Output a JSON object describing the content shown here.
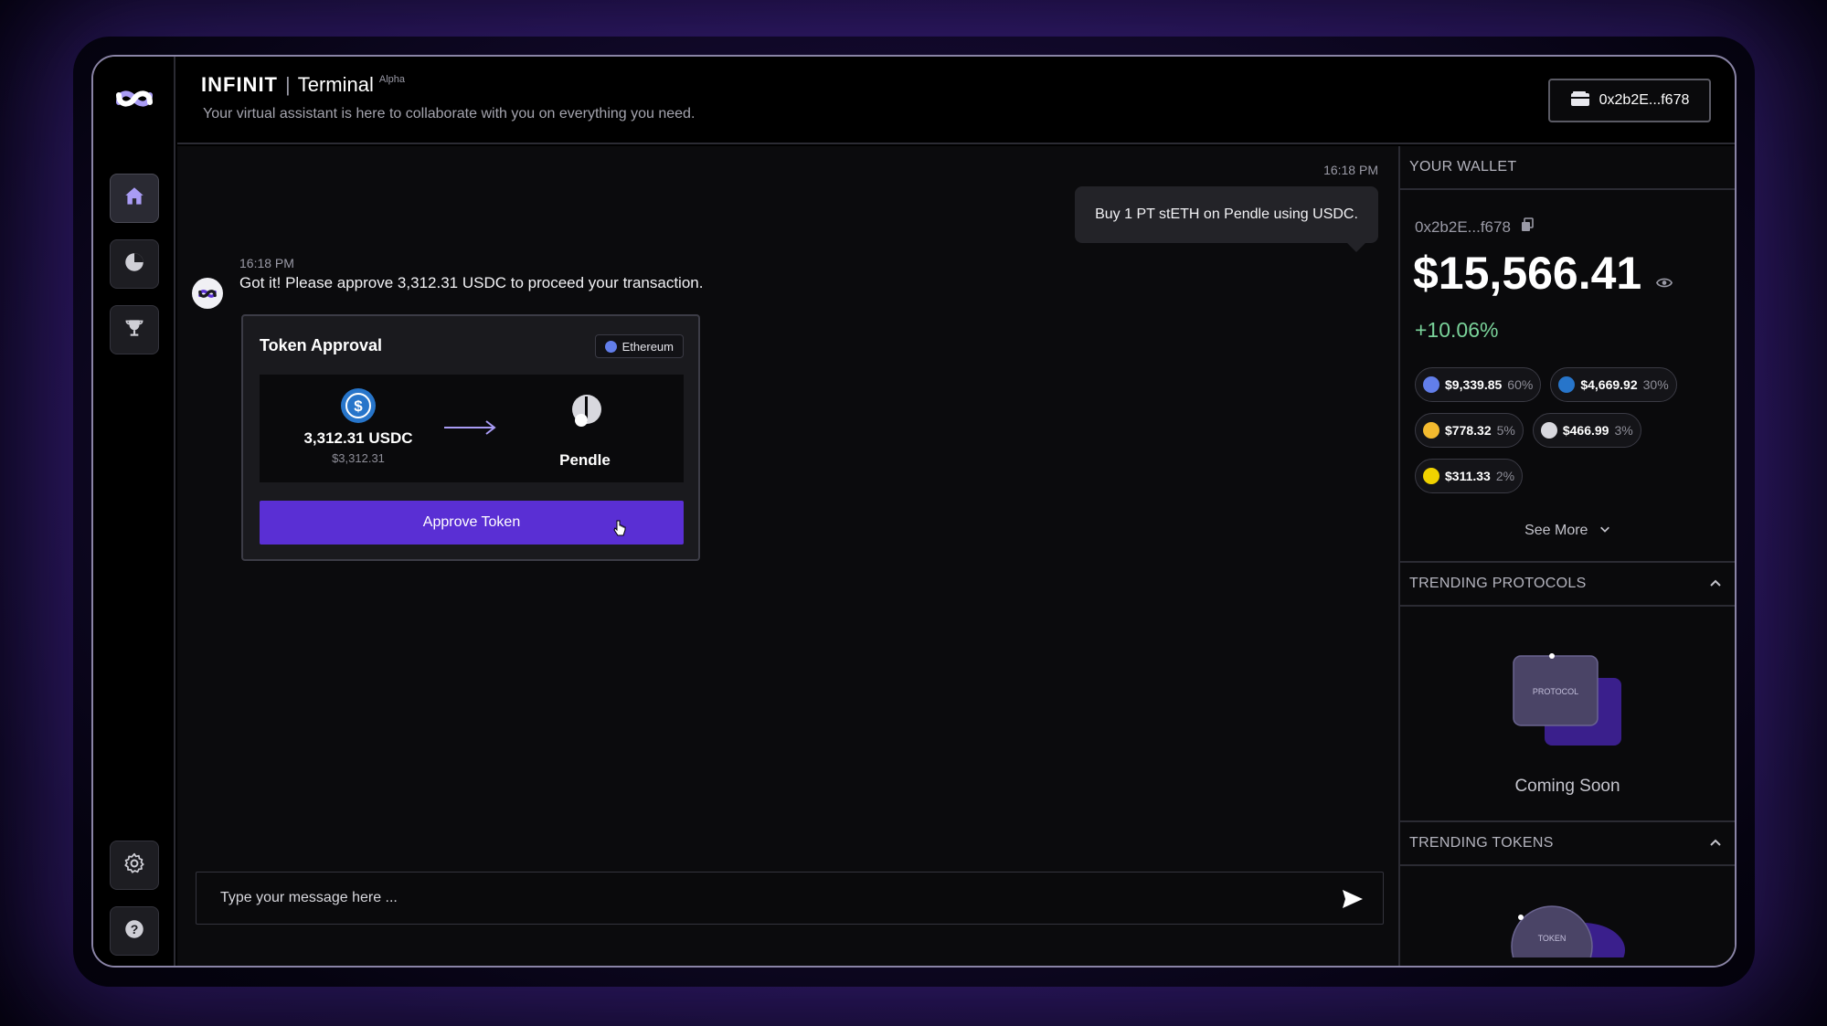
{
  "header": {
    "brand_name": "INFINIT",
    "brand_separator": "|",
    "brand_sub": "Terminal",
    "brand_tag": "Alpha",
    "tagline": "Your virtual assistant is here to collaborate with you on everything you need.",
    "wallet_button": "0x2b2E...f678"
  },
  "sidebar": {
    "items": [
      {
        "icon": "home-icon",
        "active": true
      },
      {
        "icon": "pie-chart-icon",
        "active": false
      },
      {
        "icon": "trophy-icon",
        "active": false
      }
    ],
    "bottom_items": [
      {
        "icon": "gear-icon"
      },
      {
        "icon": "help-icon"
      }
    ]
  },
  "chat": {
    "user_message": {
      "time": "16:18 PM",
      "text": "Buy 1 PT stETH on Pendle using USDC."
    },
    "bot_message": {
      "time": "16:18 PM",
      "text": "Got it! Please approve 3,312.31 USDC to proceed your transaction."
    },
    "approval_card": {
      "title": "Token Approval",
      "chain": "Ethereum",
      "from_amount": "3,312.31 USDC",
      "from_usd": "$3,312.31",
      "to_label": "Pendle",
      "button_label": "Approve Token"
    },
    "input_placeholder": "Type your message here ..."
  },
  "wallet": {
    "section_title": "YOUR WALLET",
    "address": "0x2b2E...f678",
    "balance": "$15,566.41",
    "change": "+10.06%",
    "holdings": [
      {
        "value": "$9,339.85",
        "pct": "60%",
        "color": "#627eea"
      },
      {
        "value": "$4,669.92",
        "pct": "30%",
        "color": "#2775ca"
      },
      {
        "value": "$778.32",
        "pct": "5%",
        "color": "#f3ba2f"
      },
      {
        "value": "$466.99",
        "pct": "3%",
        "color": "#d8d8de"
      },
      {
        "value": "$311.33",
        "pct": "2%",
        "color": "#f0d200"
      }
    ],
    "see_more": "See More"
  },
  "trending_protocols": {
    "title": "TRENDING PROTOCOLS",
    "art_label": "PROTOCOL",
    "status": "Coming Soon"
  },
  "trending_tokens": {
    "title": "TRENDING TOKENS",
    "art_label": "TOKEN"
  },
  "colors": {
    "accent": "#5a2fd4",
    "positive": "#7ad39a"
  }
}
